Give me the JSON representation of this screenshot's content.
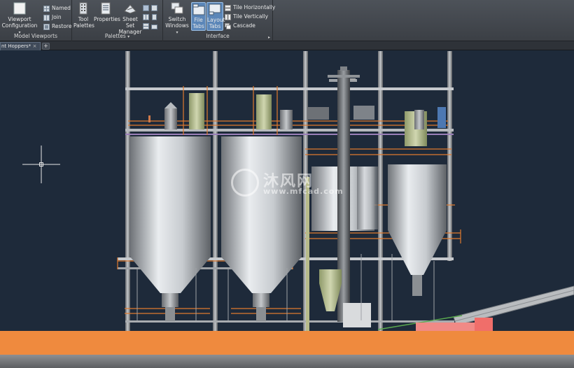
{
  "ribbon": {
    "model_viewports": {
      "title": "Model Viewports",
      "viewport_configuration": "Viewport Configuration",
      "named": "Named",
      "join": "Join",
      "restore": "Restore"
    },
    "palettes": {
      "title": "Palettes",
      "tool_palettes": "Tool Palettes",
      "properties": "Properties",
      "sheet_set_manager": "Sheet Set Manager"
    },
    "interface": {
      "title": "Interface",
      "switch_windows": "Switch Windows",
      "file_tabs": "File Tabs",
      "layout_tabs": "Layout Tabs",
      "tile_horizontally": "Tile Horizontally",
      "tile_vertically": "Tile Vertically",
      "cascade": "Cascade"
    }
  },
  "tabs": {
    "active": "nt Hoppers*",
    "close": "×",
    "add": "+"
  },
  "watermark": {
    "brand": "沐风网",
    "url": "www.mfcad.com"
  },
  "colors": {
    "background": "#1e2a3a",
    "ground": "#ef8a3e",
    "accent_active": "#5b86b8",
    "railing": "#e07a2e"
  }
}
